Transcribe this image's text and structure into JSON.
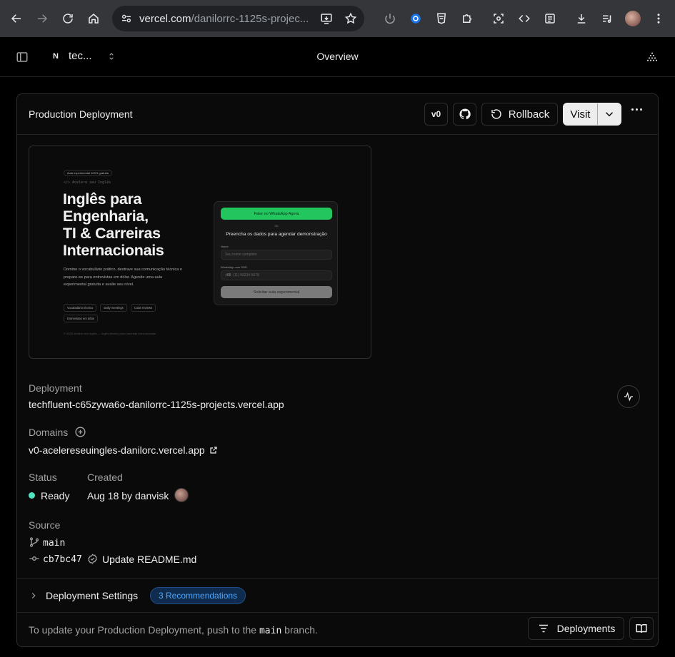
{
  "browser": {
    "url_host": "vercel.com",
    "url_path": "/danilorrc-1125s-projec...",
    "colors": {
      "chrome_bg": "#35363a",
      "omnibox_bg": "#202124"
    }
  },
  "topbar": {
    "team_name": "tec...",
    "page_title": "Overview"
  },
  "card": {
    "title": "Production Deployment",
    "buttons": {
      "v0": "v0",
      "rollback": "Rollback",
      "visit": "Visit"
    }
  },
  "preview": {
    "badge": "Aula experimental 100% gratuita",
    "code_line": "</> Acelere seu Inglês",
    "headline": [
      "Inglês para",
      "Engenharia,",
      "TI & Carreiras",
      "Internacionais"
    ],
    "description": "Domine o vocabulário prático, destrave sua comunicação técnica e prepare-se para entrevistas em dólar. Agende uma aula experimental gratuita e avalie seu nível.",
    "chips": [
      "Vocabulário técnico",
      "Daily meetings",
      "Code reviews",
      "Entrevistas em dólar"
    ],
    "footer": "© 2025 Acelere seu Inglês — Inglês técnico para carreiras internacionais.",
    "form": {
      "whatsapp_button": "Falar no WhatsApp Agora",
      "or": "ou",
      "title": "Preencha os dados para agendar demonstração",
      "name_label": "Nome",
      "name_placeholder": "Seu nome completo",
      "phone_label": "WhatsApp com DDD",
      "phone_prefix": "+55",
      "phone_placeholder": "(11) 99234-5678",
      "submit": "Solicitar aula experimental"
    }
  },
  "details": {
    "deployment_label": "Deployment",
    "deployment_value": "techfluent-c65zywa6o-danilorrc-1125s-projects.vercel.app",
    "domains_label": "Domains",
    "domain_value": "v0-acelereseuingles-danilorc.vercel.app",
    "status_label": "Status",
    "status_value": "Ready",
    "status_color": "#50e3c2",
    "created_label": "Created",
    "created_value": "Aug 18 by danvisk",
    "source_label": "Source",
    "branch": "main",
    "commit_hash": "cb7bc47",
    "commit_message": "Update README.md"
  },
  "settings": {
    "title": "Deployment Settings",
    "recommendations": "3 Recommendations"
  },
  "footer": {
    "text_before": "To update your Production Deployment, push to the ",
    "branch": "main",
    "text_after": " branch.",
    "deployments_button": "Deployments"
  }
}
